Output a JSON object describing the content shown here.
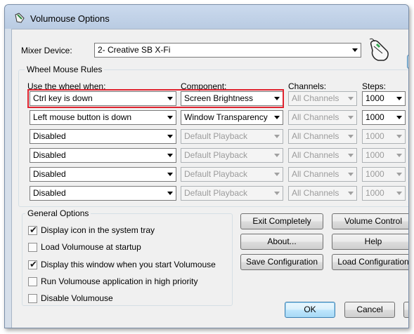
{
  "window": {
    "title": "Volumouse Options"
  },
  "mixer": {
    "label": "Mixer Device:",
    "value": "2- Creative SB X-Fi"
  },
  "rules": {
    "group_title": "Wheel Mouse Rules",
    "headers": {
      "use_when": "Use the wheel when:",
      "component": "Component:",
      "channels": "Channels:",
      "steps": "Steps:"
    },
    "rows": [
      {
        "condition": "Ctrl key is down",
        "component": "Screen Brightness",
        "channels": "All Channels",
        "steps": "1000"
      },
      {
        "condition": "Left mouse button is down",
        "component": "Window Transparency",
        "channels": "All Channels",
        "steps": "1000"
      },
      {
        "condition": "Disabled",
        "component": "Default Playback",
        "channels": "All Channels",
        "steps": "1000"
      },
      {
        "condition": "Disabled",
        "component": "Default Playback",
        "channels": "All Channels",
        "steps": "1000"
      },
      {
        "condition": "Disabled",
        "component": "Default Playback",
        "channels": "All Channels",
        "steps": "1000"
      },
      {
        "condition": "Disabled",
        "component": "Default Playback",
        "channels": "All Channels",
        "steps": "1000"
      }
    ]
  },
  "general": {
    "group_title": "General Options",
    "options": [
      {
        "label": "Display icon in the system tray",
        "checked": "✔"
      },
      {
        "label": "Load Volumouse at startup",
        "checked": ""
      },
      {
        "label": "Display this window when you start Volumouse",
        "checked": "✔"
      },
      {
        "label": "Run Volumouse application in high priority",
        "checked": ""
      },
      {
        "label": "Disable Volumouse",
        "checked": ""
      }
    ]
  },
  "buttons": {
    "exit": "Exit Completely",
    "volume_control": "Volume Control",
    "about": "About...",
    "help": "Help",
    "save_config": "Save Configuration",
    "load_config": "Load Configuration",
    "ok": "OK",
    "cancel": "Cancel"
  },
  "colors": {
    "highlight": "#e0232f",
    "client_bg": "#f0f0f0",
    "titlebar": "#cbdaee"
  }
}
